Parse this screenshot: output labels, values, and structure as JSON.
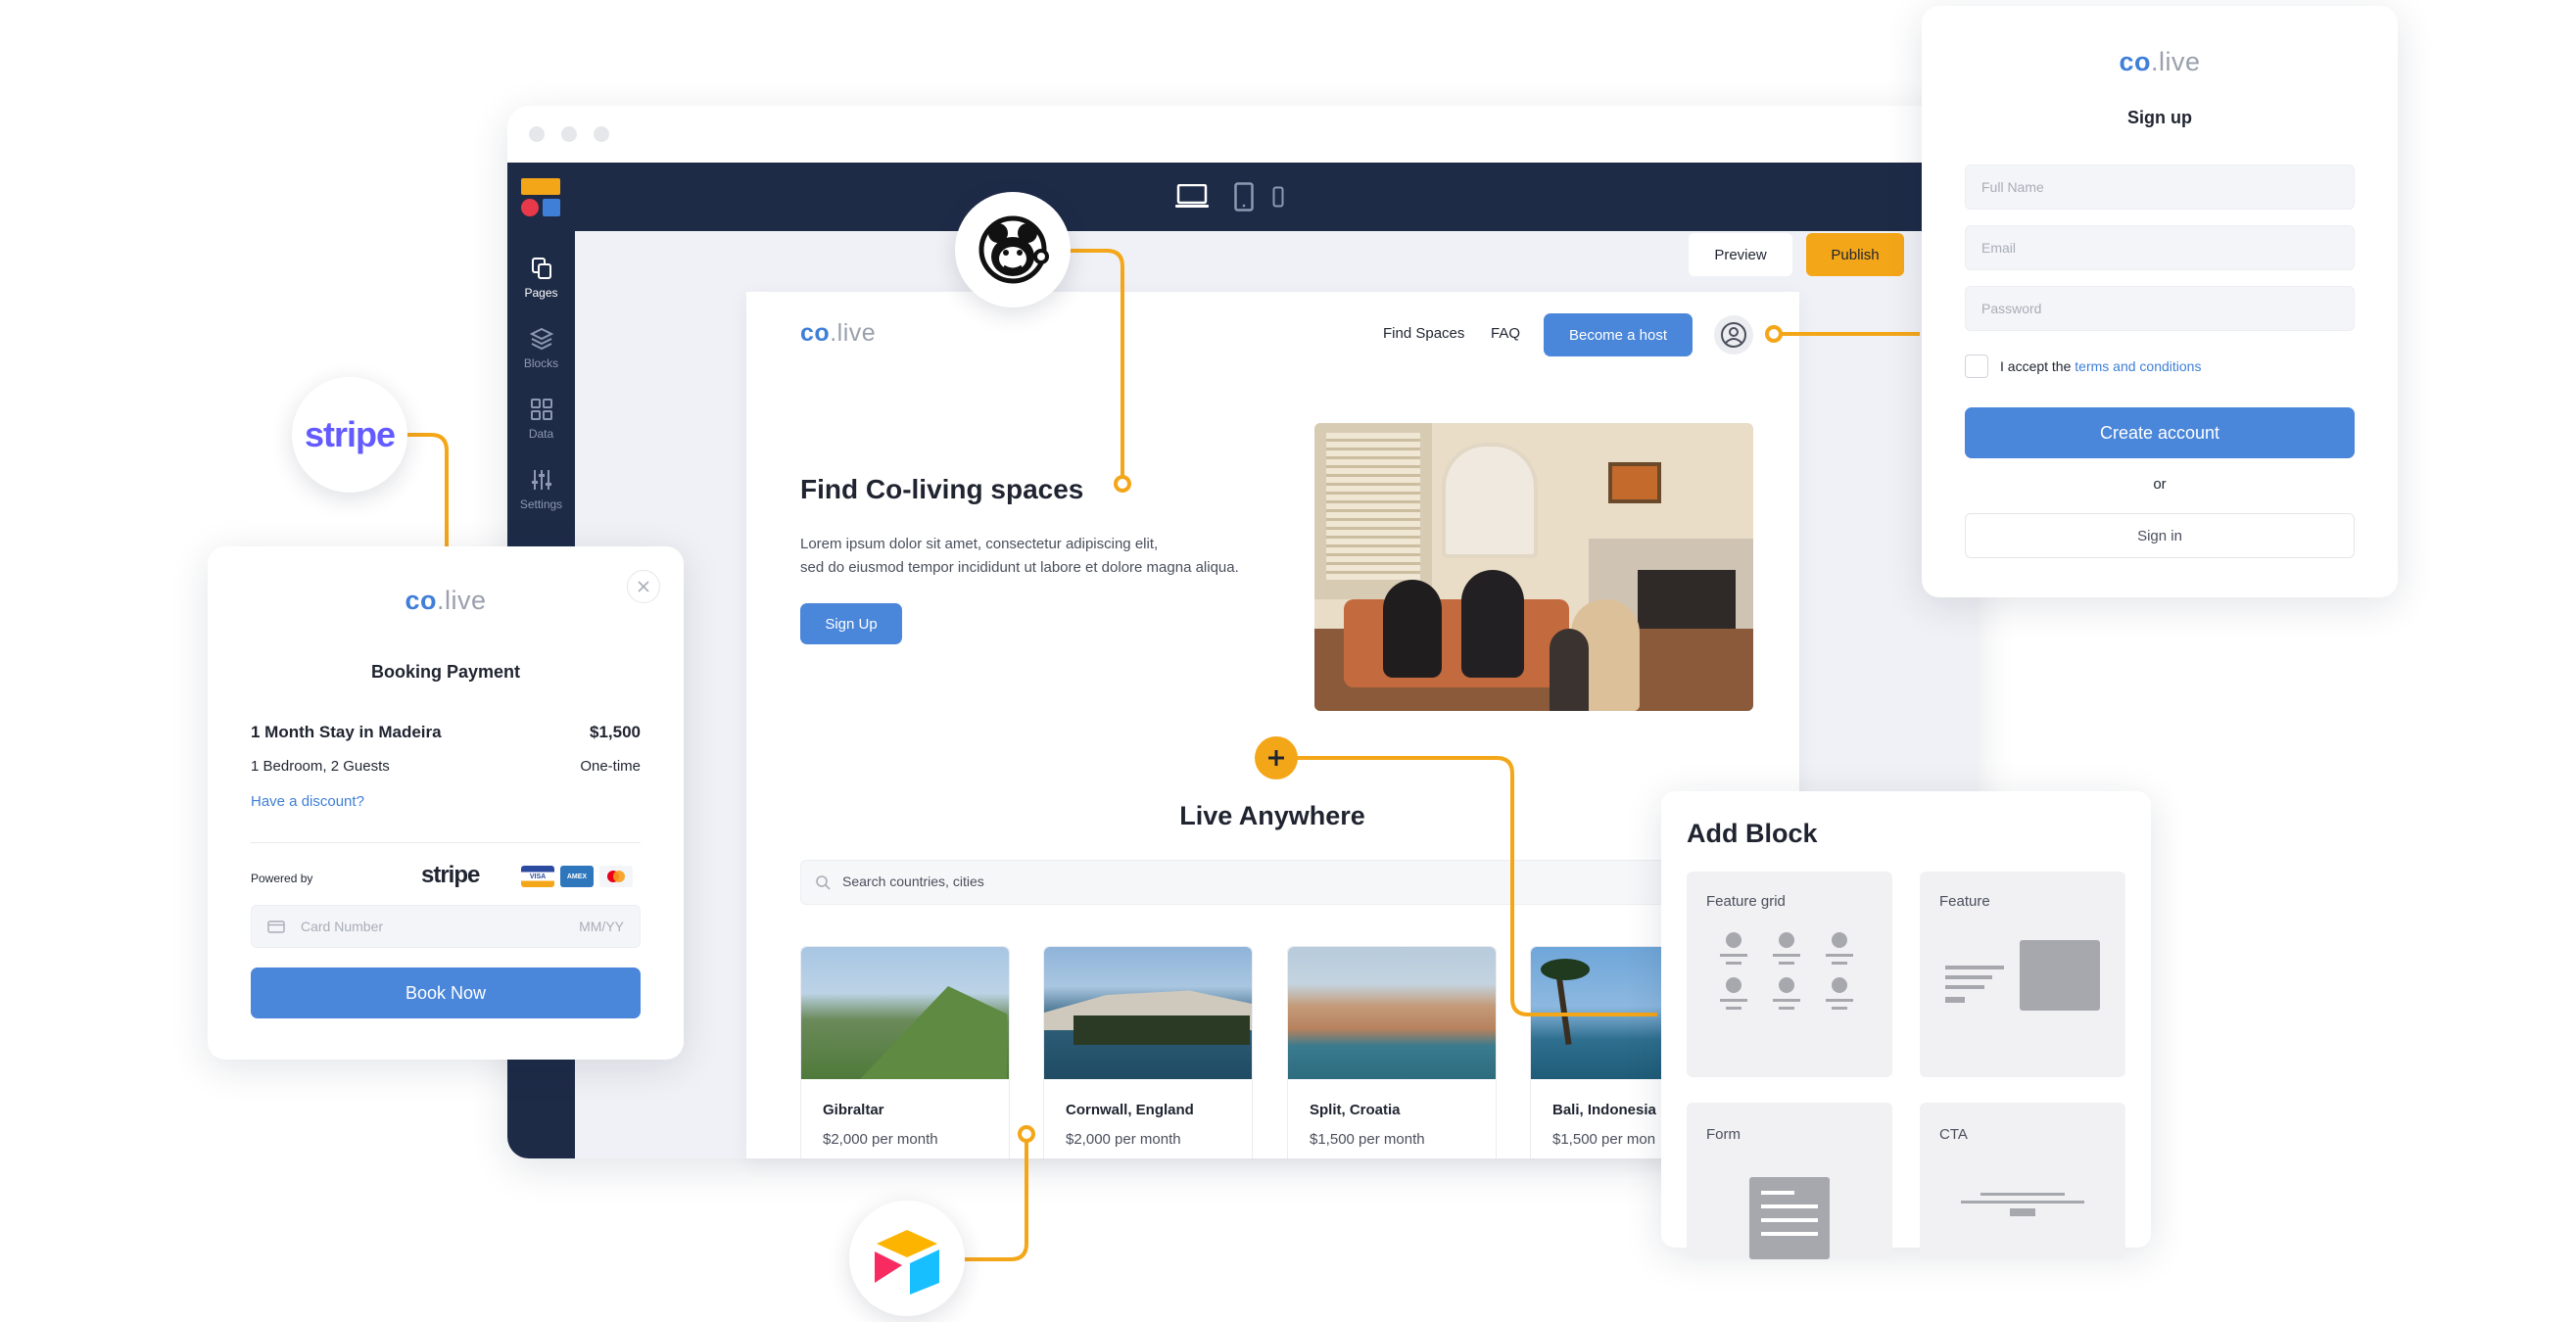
{
  "builder": {
    "toolbar": {
      "preview_label": "Preview",
      "publish_label": "Publish"
    },
    "sidebar": [
      {
        "label": "Pages",
        "icon": "pages-icon"
      },
      {
        "label": "Blocks",
        "icon": "blocks-icon"
      },
      {
        "label": "Data",
        "icon": "data-icon"
      },
      {
        "label": "Settings",
        "icon": "settings-icon"
      }
    ],
    "devices": [
      "desktop-icon",
      "tablet-icon",
      "mobile-icon"
    ]
  },
  "site": {
    "logo_co": "co",
    "logo_live": ".live",
    "nav": {
      "find_spaces": "Find Spaces",
      "faq": "FAQ",
      "become_host": "Become a host"
    },
    "hero": {
      "title": "Find Co-living spaces",
      "body_line1": "Lorem ipsum dolor sit amet, consectetur adipiscing elit,",
      "body_line2": "sed do eiusmod tempor incididunt ut labore et dolore magna aliqua.",
      "cta": "Sign Up"
    },
    "live_anywhere": {
      "title": "Live Anywhere",
      "search_placeholder": "Search countries, cities",
      "locations": [
        {
          "name": "Gibraltar",
          "price": "$2,000 per month"
        },
        {
          "name": "Cornwall, England",
          "price": "$2,000 per month"
        },
        {
          "name": "Split, Croatia",
          "price": "$1,500 per month"
        },
        {
          "name": "Bali, Indonesia",
          "price": "$1,500 per mon"
        }
      ]
    }
  },
  "signup": {
    "logo_co": "co",
    "logo_live": ".live",
    "title": "Sign up",
    "full_name_placeholder": "Full Name",
    "email_placeholder": "Email",
    "password_placeholder": "Password",
    "accept_prefix": "I accept the ",
    "terms_link": "terms and conditions",
    "create_account": "Create account",
    "or": "or",
    "sign_in": "Sign in"
  },
  "payment": {
    "logo_co": "co",
    "logo_live": ".live",
    "title": "Booking Payment",
    "item_name": "1 Month Stay in Madeira",
    "item_price": "$1,500",
    "item_detail": "1 Bedroom, 2 Guests",
    "item_frequency": "One-time",
    "discount_link": "Have a discount?",
    "powered_by": "Powered by",
    "stripe_word": "stripe",
    "card_placeholder": "Card Number",
    "expiry_placeholder": "MM/YY",
    "book_now": "Book Now",
    "card_brands": [
      "VISA",
      "AMEX",
      "mastercard"
    ]
  },
  "add_block": {
    "title": "Add Block",
    "tiles": [
      {
        "label": "Feature grid"
      },
      {
        "label": "Feature"
      },
      {
        "label": "Form"
      },
      {
        "label": "CTA"
      }
    ]
  },
  "integrations": {
    "stripe_badge": "stripe",
    "icons": [
      "mailchimp-icon",
      "airtable-icon",
      "add-block-plus-icon"
    ]
  },
  "colors": {
    "navy": "#1e2b47",
    "accent_orange": "#f4a619",
    "primary_blue": "#4a86d9",
    "stripe_purple": "#635bff"
  }
}
